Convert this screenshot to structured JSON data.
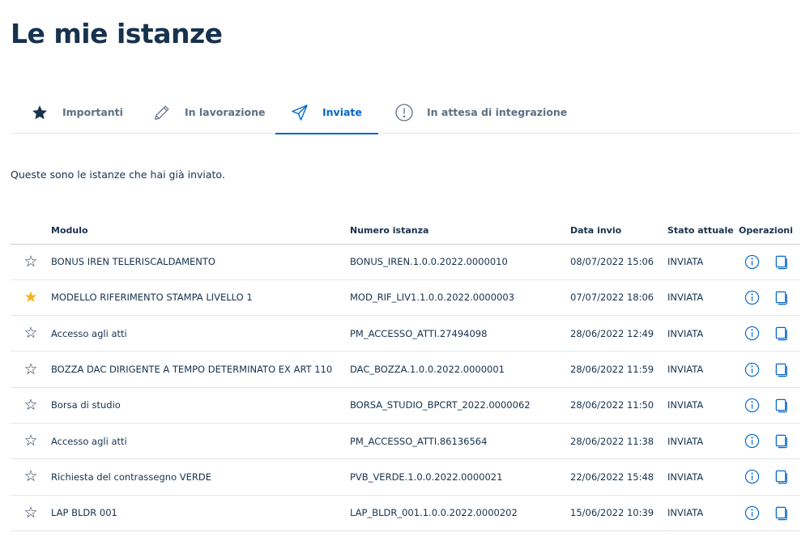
{
  "page_title": "Le mie istanze",
  "tabs": [
    {
      "label": "Importanti",
      "icon": "star-icon",
      "active": false
    },
    {
      "label": "In lavorazione",
      "icon": "pencil-icon",
      "active": false
    },
    {
      "label": "Inviate",
      "icon": "paper-plane-icon",
      "active": true
    },
    {
      "label": "In attesa di integrazione",
      "icon": "exclamation-circle-icon",
      "active": false
    }
  ],
  "intro_text": "Queste sono le istanze che hai già inviato.",
  "table": {
    "headers": {
      "modulo": "Modulo",
      "numero": "Numero istanza",
      "data": "Data invio",
      "stato": "Stato attuale",
      "operazioni": "Operazioni"
    },
    "rows": [
      {
        "starred": false,
        "modulo": "BONUS IREN TELERISCALDAMENTO",
        "numero": "BONUS_IREN.1.0.0.2022.0000010",
        "data": "08/07/2022 15:06",
        "stato": "INVIATA"
      },
      {
        "starred": true,
        "modulo": "MODELLO RIFERIMENTO STAMPA LIVELLO 1",
        "numero": "MOD_RIF_LIV1.1.0.0.2022.0000003",
        "data": "07/07/2022 18:06",
        "stato": "INVIATA"
      },
      {
        "starred": false,
        "modulo": "Accesso agli atti",
        "numero": "PM_ACCESSO_ATTI.27494098",
        "data": "28/06/2022 12:49",
        "stato": "INVIATA"
      },
      {
        "starred": false,
        "modulo": "BOZZA DAC DIRIGENTE A TEMPO DETERMINATO EX ART 110",
        "numero": "DAC_BOZZA.1.0.0.2022.0000001",
        "data": "28/06/2022 11:59",
        "stato": "INVIATA"
      },
      {
        "starred": false,
        "modulo": "Borsa di studio",
        "numero": "BORSA_STUDIO_BPCRT_2022.0000062",
        "data": "28/06/2022 11:50",
        "stato": "INVIATA"
      },
      {
        "starred": false,
        "modulo": "Accesso agli atti",
        "numero": "PM_ACCESSO_ATTI.86136564",
        "data": "28/06/2022 11:38",
        "stato": "INVIATA"
      },
      {
        "starred": false,
        "modulo": "Richiesta del contrassegno VERDE",
        "numero": "PVB_VERDE.1.0.0.2022.0000021",
        "data": "22/06/2022 15:48",
        "stato": "INVIATA"
      },
      {
        "starred": false,
        "modulo": "LAP BLDR 001",
        "numero": "LAP_BLDR_001.1.0.0.2022.0000202",
        "data": "15/06/2022 10:39",
        "stato": "INVIATA"
      }
    ]
  },
  "colors": {
    "primary": "#0066cc",
    "text": "#17324d",
    "muted": "#5c6f82",
    "star_filled": "#f2b31d"
  }
}
